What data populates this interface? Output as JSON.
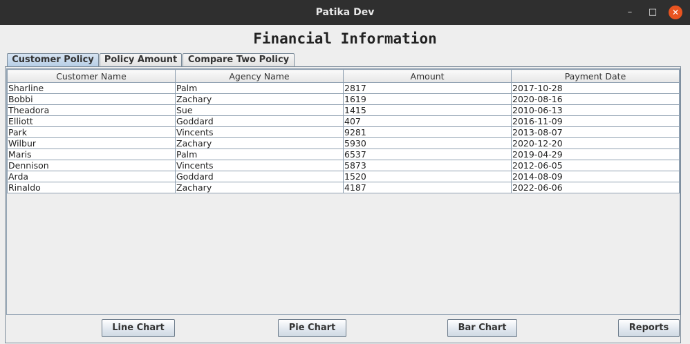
{
  "window": {
    "title": "Patika Dev",
    "min_icon": "minimize-icon",
    "max_icon": "maximize-icon",
    "close_icon": "close-icon",
    "min_glyph": "–",
    "max_glyph": "□",
    "close_glyph": "✕",
    "close_color": "#e95420"
  },
  "heading": "Financial Information",
  "tabs": [
    {
      "label": "Customer Policy",
      "active": true
    },
    {
      "label": "Policy Amount",
      "active": false
    },
    {
      "label": "Compare Two Policy",
      "active": false
    }
  ],
  "table": {
    "columns": [
      "Customer Name",
      "Agency Name",
      "Amount",
      "Payment Date"
    ],
    "rows": [
      [
        "Sharline",
        "Palm",
        "2817",
        "2017-10-28"
      ],
      [
        "Bobbi",
        "Zachary",
        "1619",
        "2020-08-16"
      ],
      [
        "Theadora",
        "Sue",
        "1415",
        "2010-06-13"
      ],
      [
        "Elliott",
        "Goddard",
        "407",
        "2016-11-09"
      ],
      [
        "Park",
        "Vincents",
        "9281",
        "2013-08-07"
      ],
      [
        "Wilbur",
        "Zachary",
        "5930",
        "2020-12-20"
      ],
      [
        "Maris",
        "Palm",
        "6537",
        "2019-04-29"
      ],
      [
        "Dennison",
        "Vincents",
        "5873",
        "2012-06-05"
      ],
      [
        "Arda",
        "Goddard",
        "1520",
        "2014-08-09"
      ],
      [
        "Rinaldo",
        "Zachary",
        "4187",
        "2022-06-06"
      ]
    ]
  },
  "buttons": {
    "line_chart": "Line Chart",
    "pie_chart": "Pie Chart",
    "bar_chart": "Bar Chart",
    "reports": "Reports"
  }
}
